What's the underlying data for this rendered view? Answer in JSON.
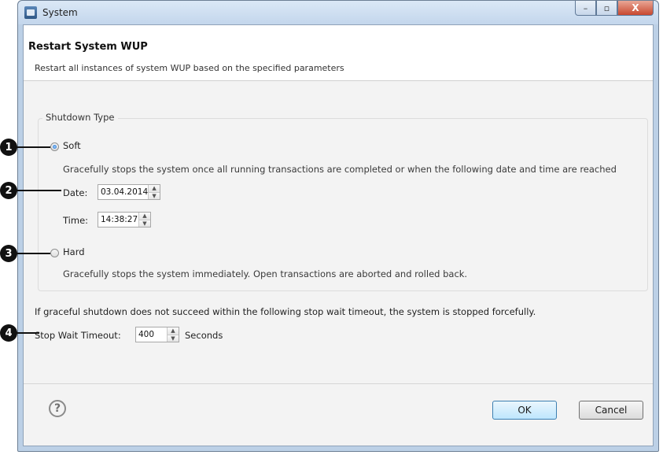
{
  "window": {
    "title": "System",
    "controls": {
      "minimize": "–",
      "maximize": "▫",
      "close": "X"
    }
  },
  "header": {
    "title": "Restart System WUP",
    "description": "Restart all instances of system WUP based on the specified parameters"
  },
  "shutdown_type": {
    "group_label": "Shutdown Type",
    "soft": {
      "label": "Soft",
      "selected": true,
      "description": "Gracefully stops the system once all running transactions are completed or when the following date and time are reached",
      "date_label": "Date:",
      "date_value": "03.04.2014",
      "time_label": "Time:",
      "time_value": "14:38:27"
    },
    "hard": {
      "label": "Hard",
      "selected": false,
      "description": "Gracefully stops the system immediately. Open transactions are aborted and rolled back."
    }
  },
  "timeout": {
    "info": "If graceful shutdown does not succeed within the following stop wait timeout, the system is stopped forcefully.",
    "label": "Stop Wait Timeout:",
    "value": "400",
    "unit": "Seconds"
  },
  "footer": {
    "help_symbol": "?",
    "ok_label": "OK",
    "cancel_label": "Cancel"
  },
  "callouts": [
    "1",
    "2",
    "3",
    "4"
  ]
}
